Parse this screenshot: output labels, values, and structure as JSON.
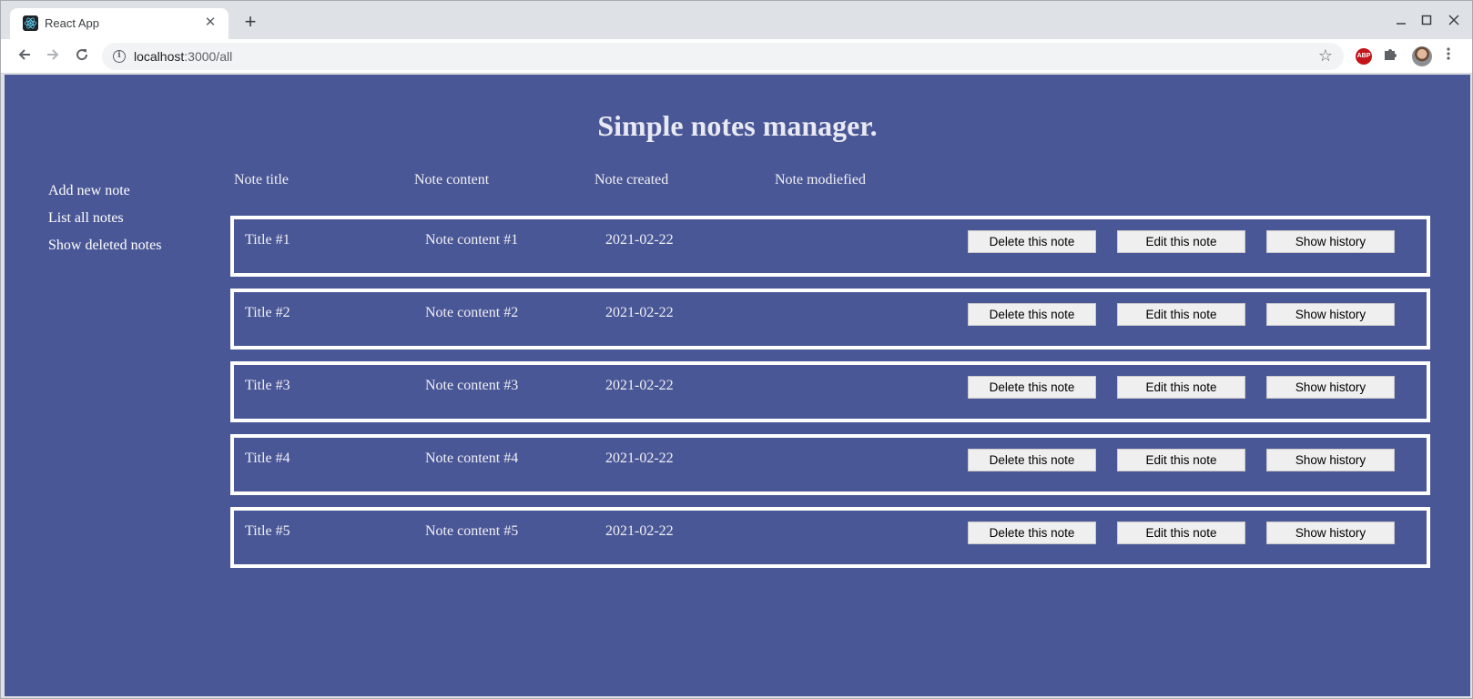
{
  "browser": {
    "tab_title": "React App",
    "tab_close": "✕",
    "new_tab": "+",
    "url_host": "localhost",
    "url_rest": ":3000/all",
    "abp_label": "ABP"
  },
  "app": {
    "title": "Simple notes manager.",
    "sidebar": [
      {
        "label": "Add new note"
      },
      {
        "label": "List all notes"
      },
      {
        "label": "Show deleted notes"
      }
    ],
    "headers": {
      "title": "Note title",
      "content": "Note content",
      "created": "Note created",
      "modified": "Note modiefied"
    },
    "buttons": {
      "delete": "Delete this note",
      "edit": "Edit this note",
      "history": "Show history"
    },
    "notes": [
      {
        "title": "Title #1",
        "content": "Note content #1",
        "created": "2021-02-22"
      },
      {
        "title": "Title #2",
        "content": "Note content #2",
        "created": "2021-02-22"
      },
      {
        "title": "Title #3",
        "content": "Note content #3",
        "created": "2021-02-22"
      },
      {
        "title": "Title #4",
        "content": "Note content #4",
        "created": "2021-02-22"
      },
      {
        "title": "Title #5",
        "content": "Note content #5",
        "created": "2021-02-22"
      }
    ]
  },
  "colors": {
    "page_background": "#4a5796",
    "note_border": "#ffffff",
    "button_background": "#efefef"
  }
}
